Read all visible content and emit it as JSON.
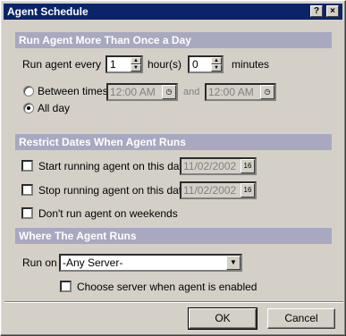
{
  "window": {
    "title": "Agent Schedule",
    "help_label": "?",
    "close_label": "×"
  },
  "sections": {
    "run_more": "Run Agent More Than Once a Day",
    "restrict": "Restrict Dates When Agent Runs",
    "where": "Where The Agent Runs"
  },
  "run_every": {
    "label": "Run agent every",
    "hours_value": "1",
    "hours_label": "hour(s)",
    "minutes_value": "0",
    "minutes_label": "minutes"
  },
  "between_times": {
    "label": "Between times",
    "selected": false,
    "start_time": "12:00 AM",
    "and_label": "and",
    "end_time": "12:00 AM"
  },
  "all_day": {
    "label": "All day",
    "selected": true
  },
  "start_date": {
    "label": "Start running agent on this date",
    "checked": false,
    "value": "11/02/2002",
    "cal_label": "16"
  },
  "stop_date": {
    "label": "Stop running agent on this date",
    "checked": false,
    "value": "11/02/2002",
    "cal_label": "16"
  },
  "weekends": {
    "label": "Don't run agent on weekends",
    "checked": false
  },
  "run_on": {
    "label": "Run on",
    "value": "-Any Server-"
  },
  "choose_server": {
    "label": "Choose server when agent is enabled",
    "checked": false
  },
  "buttons": {
    "ok": "OK",
    "cancel": "Cancel"
  }
}
